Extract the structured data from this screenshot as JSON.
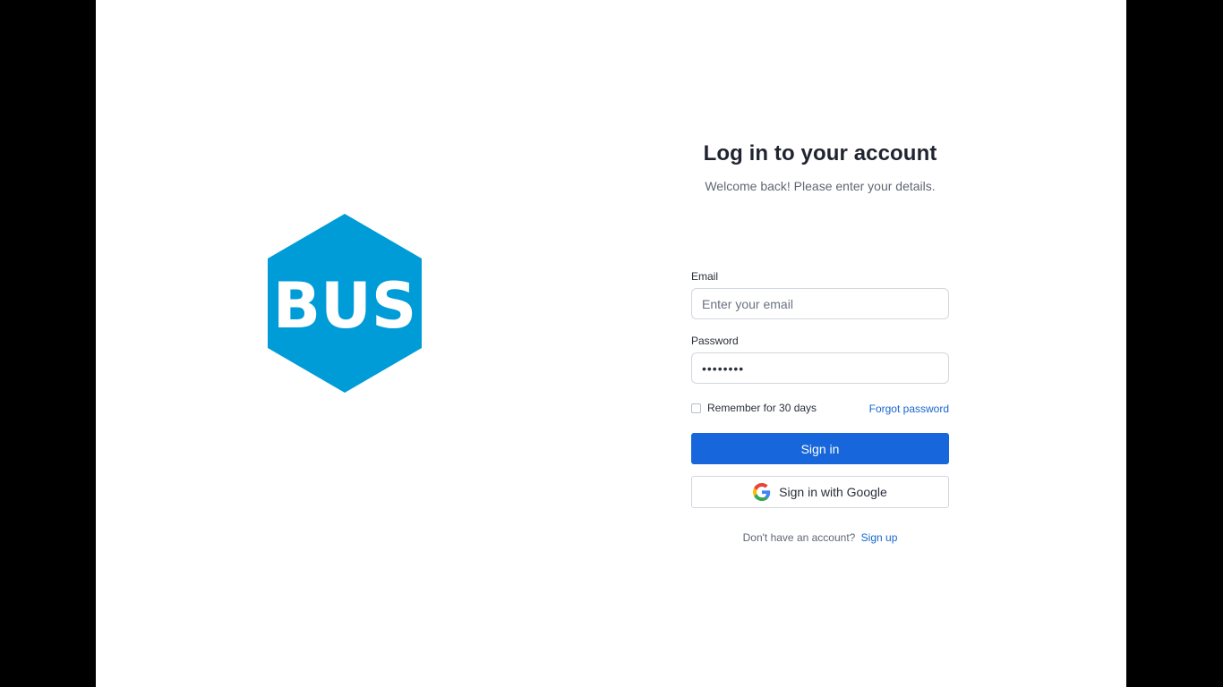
{
  "brand": {
    "logo_text": "BUS",
    "logo_color": "#009cd8"
  },
  "login": {
    "title": "Log in to your account",
    "subtitle": "Welcome back! Please enter your details.",
    "email_label": "Email",
    "email_placeholder": "Enter your email",
    "email_value": "",
    "password_label": "Password",
    "password_value": "••••••••",
    "remember_label": "Remember for 30 days",
    "remember_checked": false,
    "forgot_label": "Forgot password",
    "signin_label": "Sign in",
    "google_label": "Sign in with Google",
    "no_account_text": "Don't have an account?",
    "signup_label": "Sign up"
  },
  "colors": {
    "primary": "#1766db",
    "link": "#1766cf",
    "background": "#ffffff",
    "frame": "#000000"
  },
  "icons": {
    "google": "google-g-icon"
  }
}
